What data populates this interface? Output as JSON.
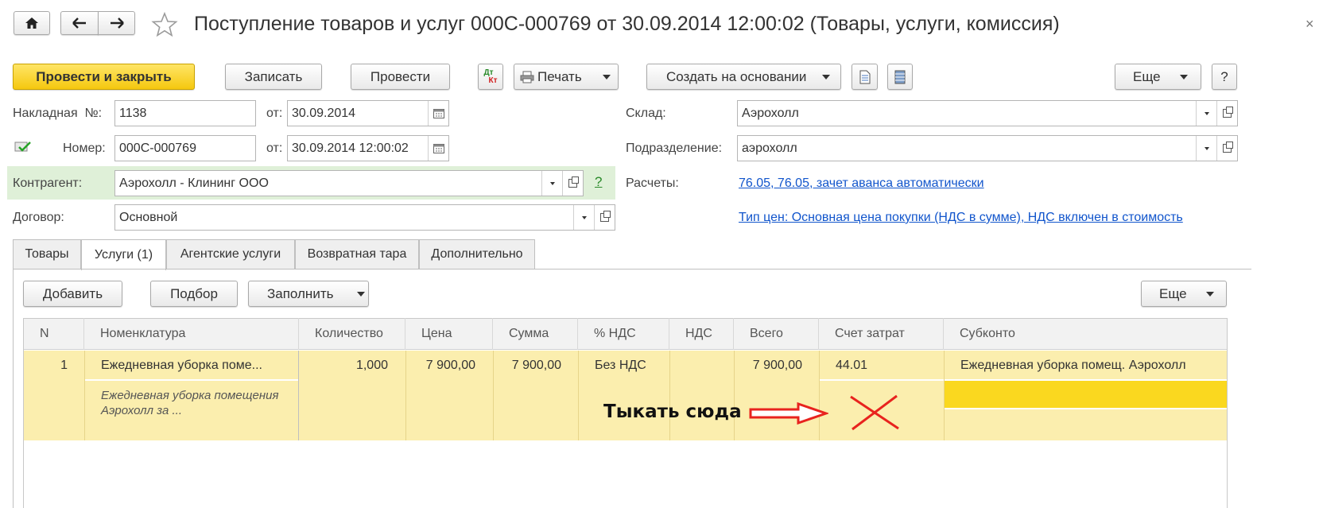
{
  "window": {
    "title": "Поступление товаров и услуг 000С-000769 от 30.09.2014 12:00:02 (Товары, услуги, комиссия)",
    "close_glyph": "×"
  },
  "toolbar": {
    "post_close": "Провести и закрыть",
    "save": "Записать",
    "post": "Провести",
    "dtkt_top": "Дт",
    "dtkt_bottom": "Кт",
    "print": "Печать",
    "create_based": "Создать на основании",
    "more": "Еще",
    "help": "?"
  },
  "form": {
    "invoice_label": "Накладная  №:",
    "invoice_no": "1138",
    "from_label": "от:",
    "invoice_date": "30.09.2014",
    "number_label": "Номер:",
    "number": "000С-000769",
    "number_date": "30.09.2014 12:00:02",
    "counterparty_label": "Контрагент:",
    "counterparty": "Аэрохолл - Клининг ООО",
    "counterparty_help": "?",
    "contract_label": "Договор:",
    "contract": "Основной",
    "warehouse_label": "Склад:",
    "warehouse": "Аэрохолл",
    "department_label": "Подразделение:",
    "department": "аэрохолл",
    "settlements_label": "Расчеты:",
    "settlements_link": "76.05, 76.05, зачет аванса автоматически",
    "price_type_link": "Тип цен: Основная цена покупки (НДС в сумме), НДС включен в стоимость"
  },
  "tabs": [
    {
      "label": "Товары"
    },
    {
      "label": "Услуги (1)"
    },
    {
      "label": "Агентские услуги"
    },
    {
      "label": "Возвратная тара"
    },
    {
      "label": "Дополнительно"
    }
  ],
  "table_toolbar": {
    "add": "Добавить",
    "pick": "Подбор",
    "fill": "Заполнить",
    "more": "Еще"
  },
  "table": {
    "columns": [
      "N",
      "Номенклатура",
      "Количество",
      "Цена",
      "Сумма",
      "% НДС",
      "НДС",
      "Всего",
      "Счет затрат",
      "Субконто"
    ],
    "rows": [
      {
        "n": "1",
        "nomenclature": "Ежедневная уборка поме...",
        "content": "Ежедневная уборка помещения  Аэрохолл за ...",
        "qty": "1,000",
        "price": "7 900,00",
        "sum": "7 900,00",
        "vat_rate": "Без НДС",
        "vat": "",
        "total": "7 900,00",
        "cost_account": "44.01",
        "subconto": "Ежедневная уборка помещ. Аэрохолл"
      }
    ]
  },
  "annotation": {
    "text": "Тыкать сюда",
    "arrow_color": "#e8231e",
    "cross_color": "#e8231e"
  },
  "colors": {
    "primary_button": "#f5c80f",
    "counterparty_bg": "#dff0d8",
    "row_highlight": "#fbeeae",
    "active_cell": "#fad81f",
    "link": "#1155cc"
  }
}
